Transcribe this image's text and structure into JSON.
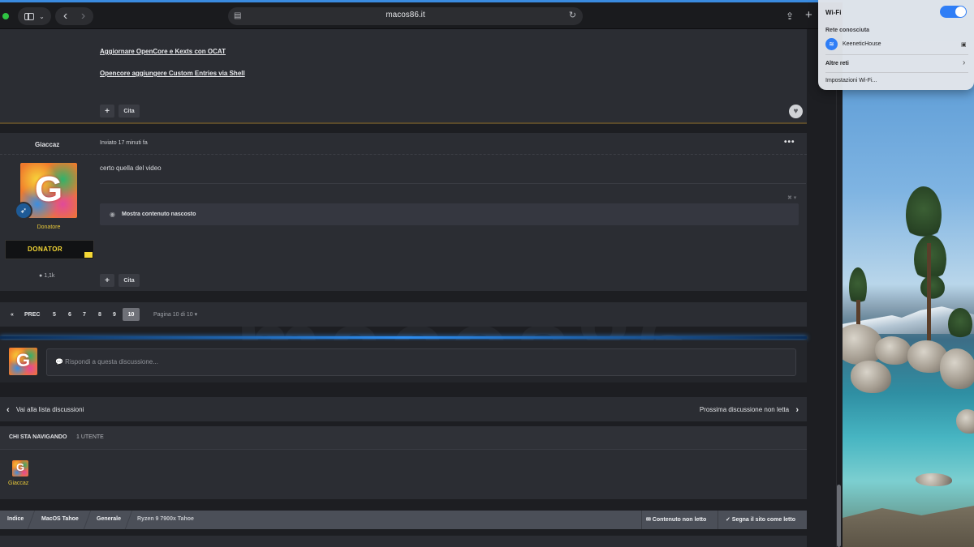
{
  "browser": {
    "url": "macos86.it",
    "accent": "#3a8be0"
  },
  "icons": {
    "sidebar": "sidebar-icon",
    "back": "‹",
    "forward": "›",
    "share": "⇪",
    "new_tab": "+",
    "reload": "↻",
    "heart": "♥",
    "more": "•••",
    "rocket": "🚀",
    "eye": "👁",
    "close": "✖ ▾",
    "comment": "💬",
    "chevron_left": "‹",
    "chevron_right": "›",
    "lock": "🔒",
    "wifi": "≋"
  },
  "post_prev": {
    "link1": "Aggiornare OpenCore e Kexts con OCAT",
    "link2": "Opencore aggiungere Custom Entries via Shell",
    "plus": "+",
    "quote": "Cita"
  },
  "post": {
    "author": "Giaccaz",
    "posted": "Inviato 17 minuti fa",
    "avatar_letter": "G",
    "role": "Donatore",
    "donator_badge": "DONATOR",
    "reputation": "1,1k",
    "text": "certo quella del video",
    "hidden_content": "Mostra contenuto nascosto",
    "plus": "+",
    "quote": "Cita"
  },
  "pagination": {
    "first": "«",
    "prev": "PREC",
    "pages": [
      "5",
      "6",
      "7",
      "8",
      "9",
      "10"
    ],
    "current": "10",
    "info": "Pagina 10 di 10 ▾"
  },
  "reply": {
    "placeholder": "💬 Rispondi a questa discussione..."
  },
  "navigation": {
    "back_to_list": "Vai alla lista discussioni",
    "next_unread": "Prossima discussione non letta"
  },
  "online": {
    "title": "CHI STA NAVIGANDO",
    "count": "1 UTENTE",
    "user": "Giaccaz"
  },
  "breadcrumb": {
    "items": [
      "Indice",
      "MacOS Tahoe",
      "Generale",
      "Ryzen 9 7900x Tahoe"
    ],
    "unread": "✉ Contenuto non letto",
    "mark_read": "✓ Segna il sito come letto"
  },
  "watermark": "macos86",
  "wifi": {
    "title": "Wi-Fi",
    "enabled": true,
    "known_label": "Rete conosciuta",
    "network": "KeeneticHouse",
    "other_label": "Altre reti",
    "settings_label": "Impostazioni Wi-Fi...",
    "accent": "#2f7ef6"
  }
}
